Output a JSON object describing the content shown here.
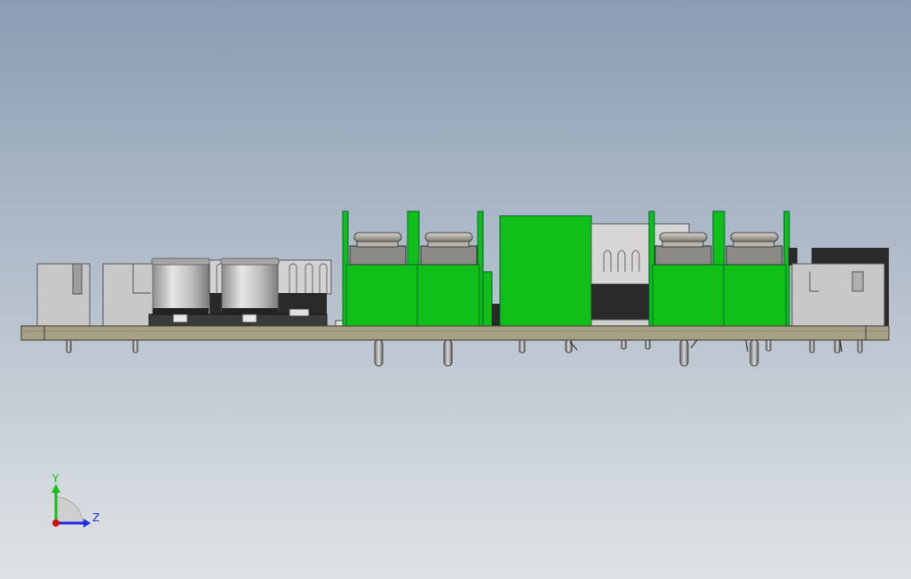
{
  "viewport": {
    "background_top": "#8b9db3",
    "background_bottom": "#dfe3e6"
  },
  "model": {
    "pcb_color": "#a79f86",
    "component_green": "#10c018",
    "connector_gray": "#c3c3c3",
    "capacitor_silver": "#bdbdbd",
    "dark_part": "#2a2a2a"
  },
  "triad": {
    "y_label": "Y",
    "z_label": "Z",
    "y_color": "#18c018",
    "z_color": "#1f2fe0",
    "origin_color": "#d01010"
  }
}
